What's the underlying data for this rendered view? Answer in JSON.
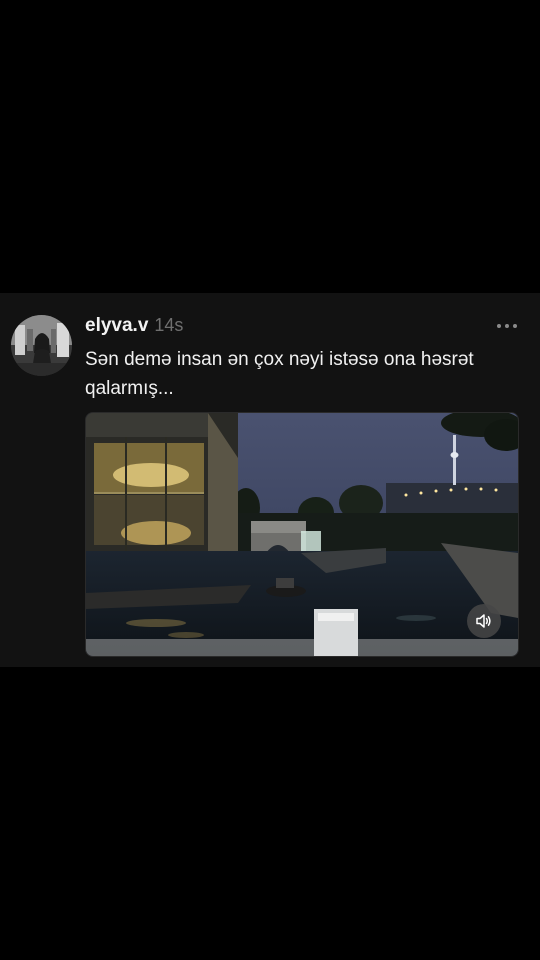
{
  "post": {
    "username": "elyva.v",
    "timestamp": "14s",
    "text": "Sən demə insan ən çox nəyi istəsə ona həsrət qalarmış...",
    "avatar_icon": "profile-photo",
    "more_icon": "more-horizontal-icon",
    "media": {
      "type": "video",
      "scene": "night canal with illuminated building, TV tower in background",
      "mute_icon": "speaker-icon"
    }
  },
  "colors": {
    "background": "#000000",
    "card": "#121212",
    "username": "#f3f3f3",
    "timestamp": "#6f6f6f",
    "text": "#f1f1f1"
  }
}
